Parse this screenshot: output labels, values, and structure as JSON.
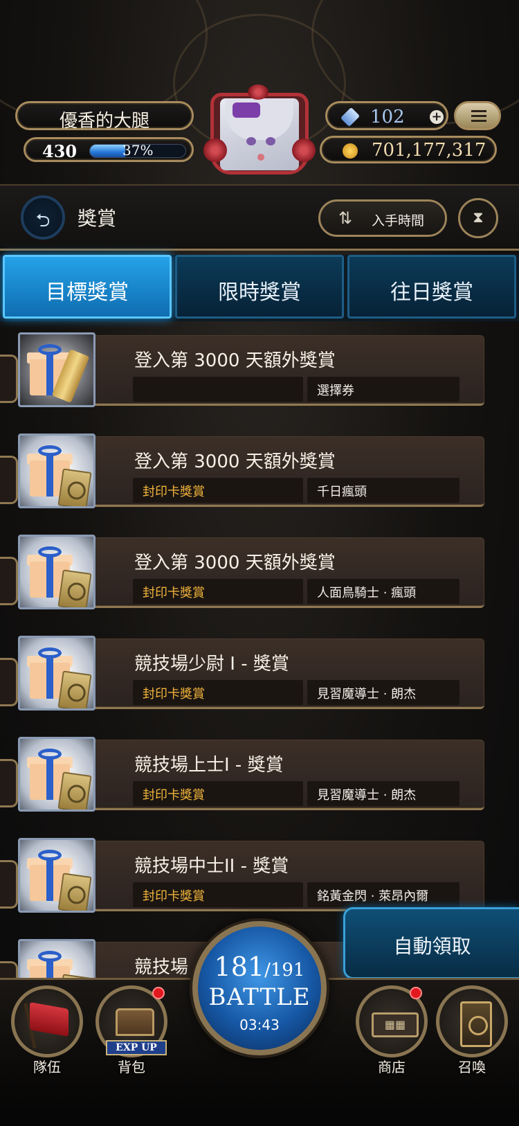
{
  "player": {
    "name": "優香的大腿",
    "level": "430",
    "exp_percent_label": "37%",
    "exp_fraction": 0.37,
    "gems": "102",
    "gold": "701,177,317"
  },
  "titlebar": {
    "title": "獎賞",
    "sort_label": "入手時間"
  },
  "tabs": [
    {
      "label": "目標獎賞",
      "active": true
    },
    {
      "label": "限時獎賞",
      "active": false
    },
    {
      "label": "往日獎賞",
      "active": false
    }
  ],
  "rewards": [
    {
      "title": "登入第 3000 天額外獎賞",
      "tag": "",
      "item": "選擇券",
      "icon": "gift-scroll-icon"
    },
    {
      "title": "登入第 3000 天額外獎賞",
      "tag": "封印卡獎賞",
      "item": "千日瘋頭",
      "icon": "gift-card-icon"
    },
    {
      "title": "登入第 3000 天額外獎賞",
      "tag": "封印卡獎賞",
      "item": "人面鳥騎士 · 瘋頭",
      "icon": "gift-card-icon"
    },
    {
      "title": "競技場少尉 I - 獎賞",
      "tag": "封印卡獎賞",
      "item": "見習魔導士 · 朗杰",
      "icon": "gift-card-icon"
    },
    {
      "title": "競技場上士I - 獎賞",
      "tag": "封印卡獎賞",
      "item": "見習魔導士 · 朗杰",
      "icon": "gift-card-icon"
    },
    {
      "title": "競技場中士II - 獎賞",
      "tag": "封印卡獎賞",
      "item": "銘黃金閃 · 萊昂內爾",
      "icon": "gift-card-icon"
    },
    {
      "title": "競技場",
      "tag": "",
      "item": "",
      "icon": "gift-card-icon"
    }
  ],
  "auto_claim_label": "自動領取",
  "bottom_nav": {
    "team_label": "隊伍",
    "bag_label": "背包",
    "exp_up_label": "EXP UP",
    "shop_label": "商店",
    "summon_label": "召喚"
  },
  "battle": {
    "stamina_current": "181",
    "stamina_max": "/191",
    "label": "BATTLE",
    "timer": "03:43"
  },
  "colors": {
    "tab_active": "#1f8fd6",
    "tab_inactive": "#0b3a57",
    "gold_border": "#a88c5e",
    "tag_text": "#f0b43a",
    "notification": "#e1191f"
  }
}
